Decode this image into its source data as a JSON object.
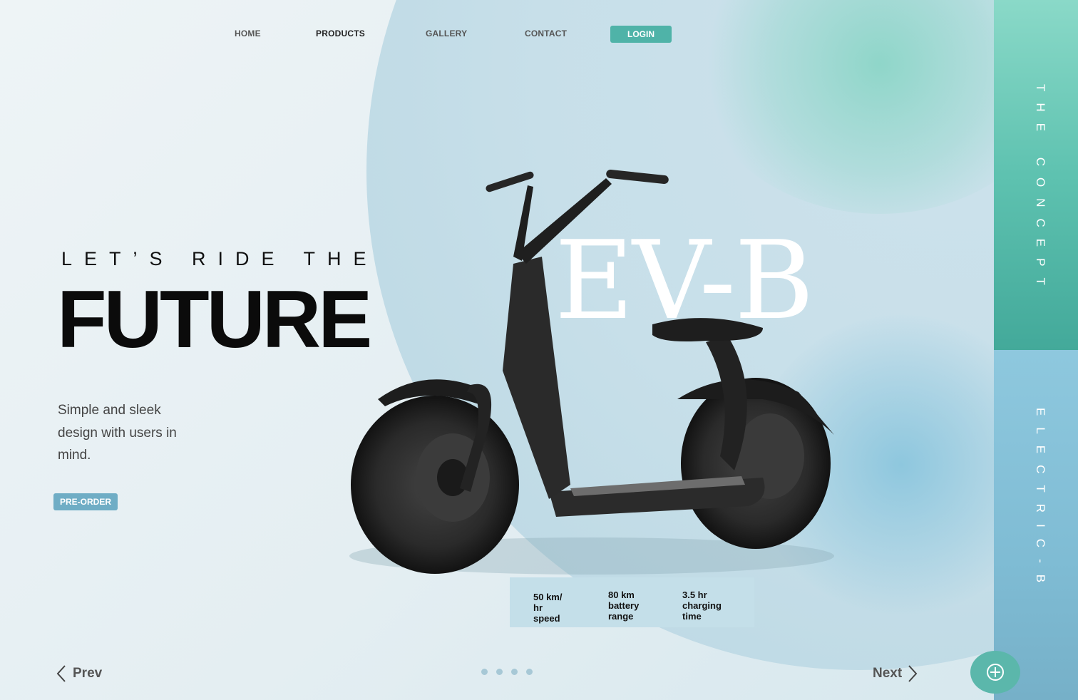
{
  "nav": {
    "items": [
      "HOME",
      "PRODUCTS",
      "GALLERY",
      "CONTACT"
    ],
    "login": "LOGIN"
  },
  "hero": {
    "kicker": "LET’S RIDE THE",
    "title": "FUTURE",
    "description": "Simple and sleek design with users in mind.",
    "preorder": "PRE-ORDER",
    "model": "EV-B"
  },
  "specs": [
    "50 km/ hr speed",
    "80 km battery range",
    "3.5 hr charging time"
  ],
  "pager": {
    "prev": "Prev",
    "next": "Next",
    "dots": 4
  },
  "side": {
    "top": "THE CONCEPT",
    "bottom": "ELECTRIC-B"
  },
  "colors": {
    "accent": "#4fb3a8",
    "preorder": "#6fadc5",
    "side_top": "#5ec2b0",
    "side_bottom": "#7fbcd4"
  },
  "icons": [
    "chevron-left-icon",
    "chevron-right-icon",
    "plus-icon"
  ]
}
